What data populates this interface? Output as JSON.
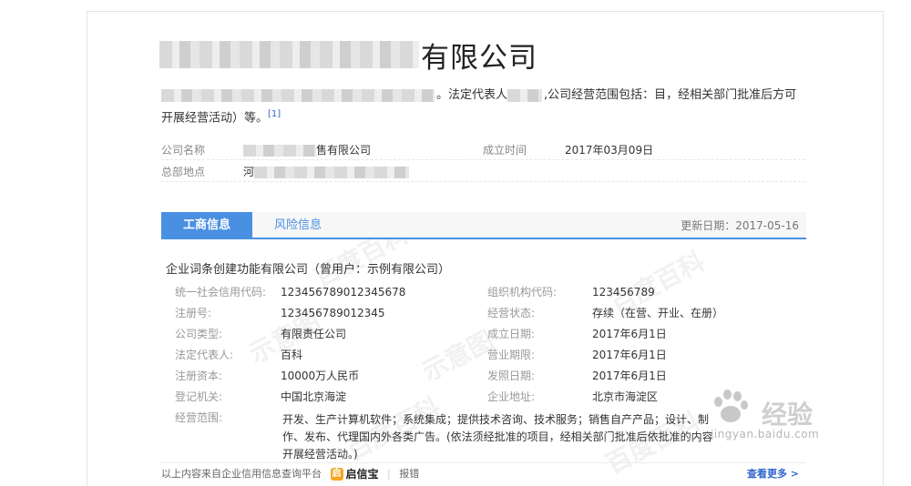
{
  "title": {
    "suffix": "有限公司"
  },
  "desc": {
    "part1": "。法定代表人",
    "part2": ",公司经营范围包括：目，经相关部门批准后方可开展经营活动）等。",
    "cite": "[1]"
  },
  "info": {
    "name_label": "公司名称",
    "name_value": "售有限公司",
    "founded_label": "成立时间",
    "founded_value": "2017年03月09日",
    "hq_label": "总部地点",
    "hq_value": "河"
  },
  "tabs": [
    {
      "label": "工商信息"
    },
    {
      "label": "风险信息"
    }
  ],
  "update": "更新日期：2017-05-16",
  "company_line": "企业词条创建功能有限公司（曾用户：示例有限公司）",
  "fields": [
    {
      "label": "统一社会信用代码:",
      "value": "123456789012345678",
      "label2": "组织机构代码:",
      "value2": "123456789"
    },
    {
      "label": "注册号:",
      "value": "123456789012345",
      "label2": "经营状态:",
      "value2": "存续（在营、开业、在册）"
    },
    {
      "label": "公司类型:",
      "value": "有限责任公司",
      "label2": "成立日期:",
      "value2": "2017年6月1日"
    },
    {
      "label": "法定代表人:",
      "value": "百科",
      "label2": "营业期限:",
      "value2": "2017年6月1日"
    },
    {
      "label": "注册资本:",
      "value": "10000万人民币",
      "label2": "发照日期:",
      "value2": "2017年6月1日"
    },
    {
      "label": "登记机关:",
      "value": "中国北京海淀",
      "label2": "企业地址:",
      "value2": "北京市海淀区"
    }
  ],
  "scope": {
    "label": "经营范围:",
    "value": "开发、生产计算机软件；系统集成；提供技术咨询、技术服务；销售自产产品；设计、制作、发布、代理国内外各类广告。(依法须经批准的项目，经相关部门批准后依批准的内容开展经营活动。)"
  },
  "footer": {
    "source": "以上内容来自企业信用信息查询平台",
    "logo": "启信宝",
    "report": "报错",
    "more": "查看更多 >"
  },
  "watermark": [
    "百度百科",
    "示意图"
  ],
  "brand": {
    "text": "经验",
    "url": "jingyan.baidu.com"
  }
}
